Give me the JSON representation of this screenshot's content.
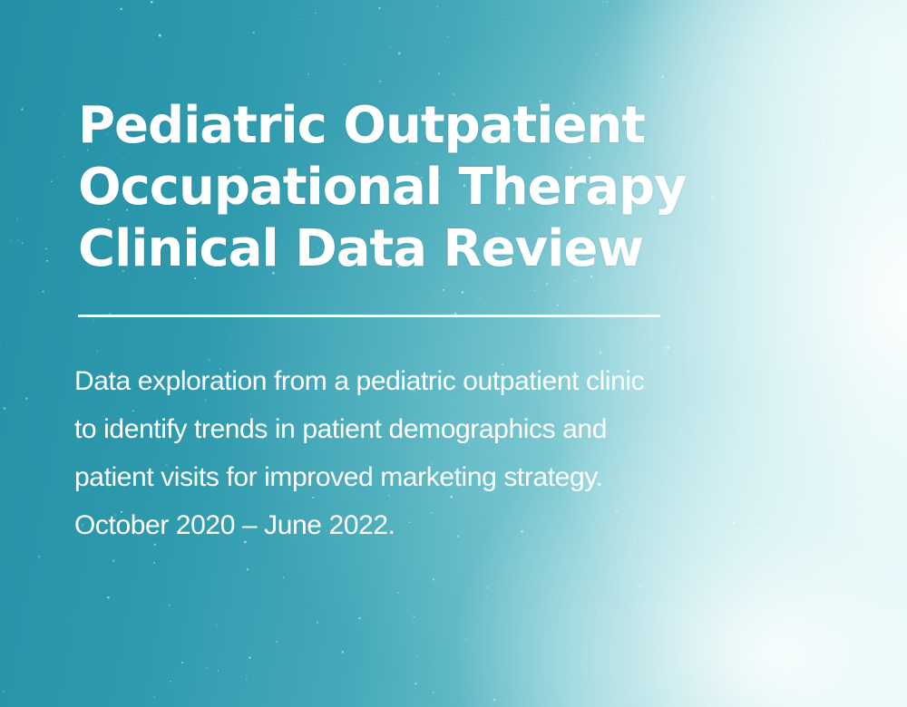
{
  "title_page": {
    "title": "Pediatric Outpatient\nOccupational Therapy\nClinical Data Review",
    "description": "Data exploration from a pediatric outpatient clinic to identify trends in patient demographics and patient visits for improved marketing strategy. October 2020 – June 2022."
  },
  "colors": {
    "background_teal": "#2a96aa",
    "background_light": "#eef9f9",
    "text": "#ffffff"
  }
}
